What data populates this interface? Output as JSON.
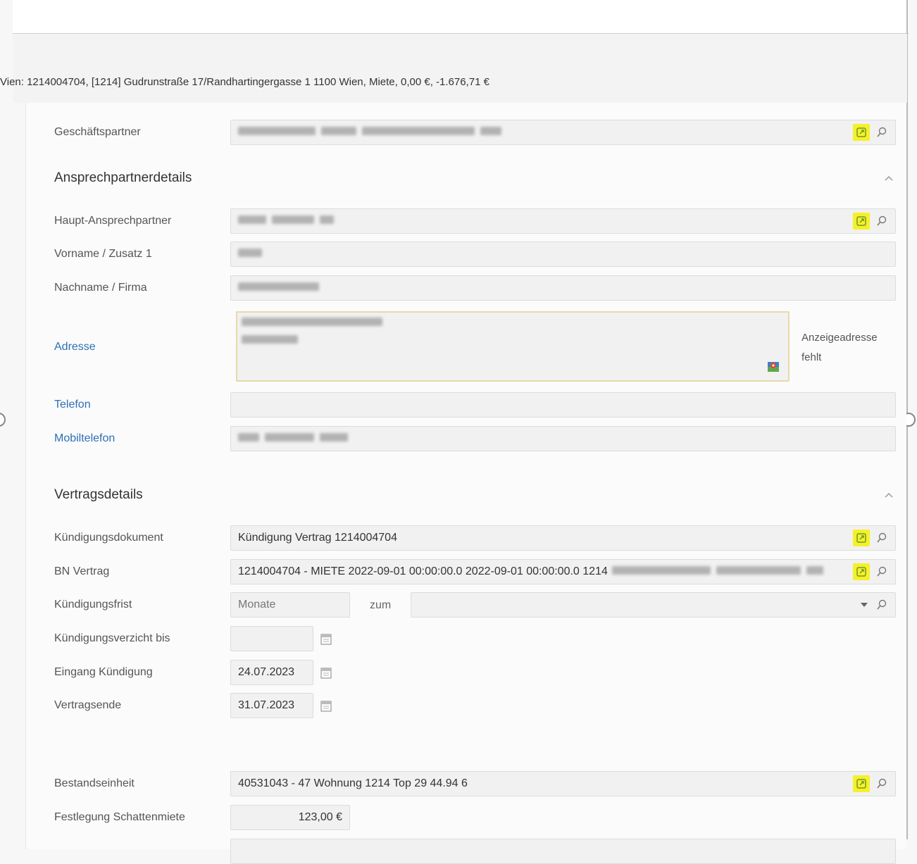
{
  "context_line": "Vien: 1214004704, [1214] Gudrunstraße 17/Randhartingergasse 1 1100 Wien, Miete, 0,00 €, -1.676,71 €",
  "fields": {
    "geschaeftspartner": {
      "label": "Geschäftspartner"
    },
    "haupt_ansprechpartner": {
      "label": "Haupt-Ansprechpartner"
    },
    "vorname": {
      "label": "Vorname / Zusatz 1"
    },
    "nachname": {
      "label": "Nachname / Firma"
    },
    "adresse": {
      "label": "Adresse",
      "note": "Anzeigeadresse fehlt"
    },
    "telefon": {
      "label": "Telefon"
    },
    "mobiltelefon": {
      "label": "Mobiltelefon"
    },
    "kuendigungsdokument": {
      "label": "Kündigungsdokument",
      "value": "Kündigung Vertrag 1214004704"
    },
    "bn_vertrag": {
      "label": "BN Vertrag",
      "value": "1214004704 - MIETE 2022-09-01 00:00:00.0 2022-09-01 00:00:00.0 1214"
    },
    "kuendigungsfrist": {
      "label": "Kündigungsfrist",
      "placeholder": "Monate",
      "zum_label": "zum"
    },
    "kuendigungsverzicht": {
      "label": "Kündigungsverzicht bis",
      "value": ""
    },
    "eingang_kuendigung": {
      "label": "Eingang Kündigung",
      "value": "24.07.2023"
    },
    "vertragsende": {
      "label": "Vertragsende",
      "value": "31.07.2023"
    },
    "bestandseinheit": {
      "label": "Bestandseinheit",
      "value": "40531043 - 47 Wohnung 1214 Top 29 44.94 6"
    },
    "schattenmiete": {
      "label": "Festlegung Schattenmiete",
      "value": "123,00 €"
    }
  },
  "sections": {
    "ansprechpartner": "Ansprechpartnerdetails",
    "vertrag": "Vertragsdetails"
  },
  "colors": {
    "highlight": "#f6f02a",
    "link": "#2e6fb5"
  },
  "icons": [
    "external-link-icon",
    "search-icon",
    "calendar-icon",
    "map-icon",
    "chevron-up-icon",
    "dropdown-arrow-icon"
  ]
}
